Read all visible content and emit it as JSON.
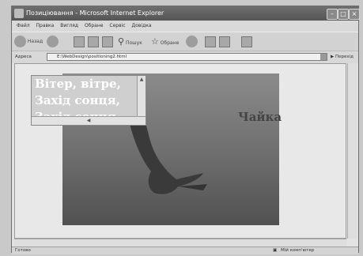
{
  "window": {
    "title": "Позиціювання - Microsoft Internet Explorer"
  },
  "menu": [
    "Файл",
    "Правка",
    "Вигляд",
    "Обране",
    "Сервіс",
    "Довідка"
  ],
  "toolbar": {
    "back_label": "Назад",
    "search_label": "Пошук",
    "favorites_label": "Обране"
  },
  "address": {
    "label": "Адреса",
    "value": "E:\\WebDesign\\positioning2.html",
    "go_label": "Перехід"
  },
  "page": {
    "textbox_lines": [
      "Вітер, вітре,",
      "Захід сонця,",
      "Захід сонця,"
    ],
    "caption": "Чайка"
  },
  "status": {
    "left": "Готово",
    "right": "Мій комп'ютер"
  },
  "colors": {
    "title_bar": "#5c5c5c",
    "sky": "#6d6d6d",
    "bird": "#3a3a3a"
  },
  "icons": [
    "ie-icon",
    "back-icon",
    "forward-icon",
    "stop-icon",
    "refresh-icon",
    "home-icon",
    "search-icon",
    "favorites-icon",
    "history-icon",
    "mail-icon",
    "print-icon",
    "page-icon",
    "go-icon",
    "computer-icon",
    "bird-image"
  ]
}
